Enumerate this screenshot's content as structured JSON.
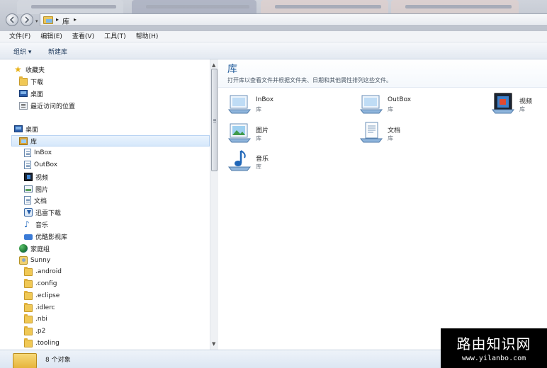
{
  "address_bar": {
    "crumbs": [
      "库"
    ]
  },
  "menu": [
    "文件(F)",
    "编辑(E)",
    "查看(V)",
    "工具(T)",
    "帮助(H)"
  ],
  "toolbar": {
    "organize": "组织 ▾",
    "new_library": "新建库"
  },
  "sidebar": {
    "favorites": {
      "label": "收藏夹",
      "items": [
        "下载",
        "桌面",
        "最近访问的位置"
      ]
    },
    "desktop": "桌面",
    "libraries": {
      "label": "库",
      "items": [
        "InBox",
        "OutBox",
        "视频",
        "图片",
        "文档",
        "迅雷下载",
        "音乐",
        "优酷影视库"
      ]
    },
    "homegroup": "家庭组",
    "user": {
      "label": "Sunny",
      "items": [
        ".android",
        ".config",
        ".eclipse",
        ".idlerc",
        ".nbi",
        ".p2",
        ".tooling"
      ]
    }
  },
  "content": {
    "title": "库",
    "description": "打开库以查看文件并根据文件夹、日期和其他属性排列这些文件。",
    "items": [
      {
        "name": "InBox",
        "kind": "库",
        "icon": "library-icon"
      },
      {
        "name": "OutBox",
        "kind": "库",
        "icon": "library-icon"
      },
      {
        "name": "视频",
        "kind": "库",
        "icon": "video-library-icon"
      },
      {
        "name": "图片",
        "kind": "库",
        "icon": "pictures-library-icon"
      },
      {
        "name": "文档",
        "kind": "库",
        "icon": "documents-library-icon"
      },
      {
        "name": "音乐",
        "kind": "库",
        "icon": "music-library-icon"
      }
    ]
  },
  "status": {
    "text": "8 个对象"
  },
  "watermark": {
    "title": "路由知识网",
    "url": "www.yilanbo.com"
  },
  "colors": {
    "accent": "#1f5a9a",
    "selection": "#d6e8fb"
  }
}
